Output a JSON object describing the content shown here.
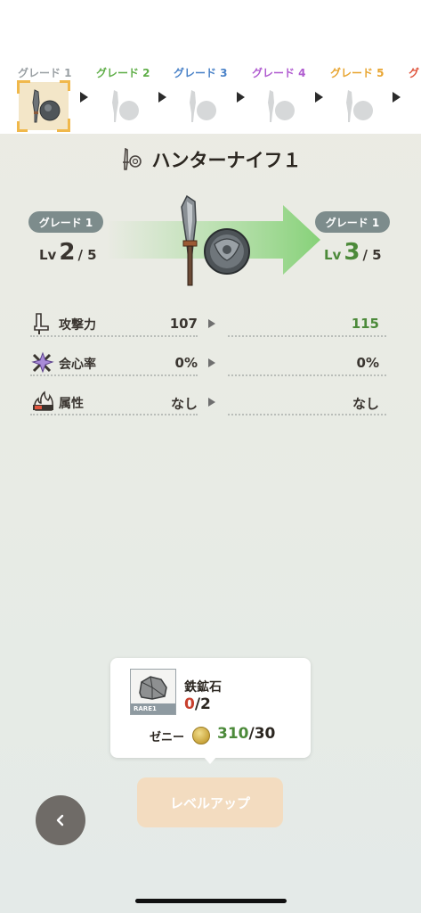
{
  "grades": [
    {
      "label": "グレード 1",
      "color": "#9aa0a4",
      "selected": true
    },
    {
      "label": "グレード 2",
      "color": "#5fae48",
      "selected": false
    },
    {
      "label": "グレード 3",
      "color": "#4a82c8",
      "selected": false
    },
    {
      "label": "グレード 4",
      "color": "#b05cd0",
      "selected": false
    },
    {
      "label": "グレード 5",
      "color": "#e8a531",
      "selected": false
    },
    {
      "label": "グ",
      "color": "#e0553e",
      "selected": false
    }
  ],
  "weapon": {
    "name": "ハンターナイフ１",
    "icon": "sword-shield-icon"
  },
  "upgrade": {
    "from": {
      "grade": "グレード 1",
      "lv_prefix": "Lv",
      "lv": "2",
      "max": "/ 5"
    },
    "to": {
      "grade": "グレード 1",
      "lv_prefix": "Lv",
      "lv": "3",
      "max": "/ 5"
    }
  },
  "stats": [
    {
      "icon": "attack-icon",
      "name": "攻撃力",
      "current": "107",
      "next": "115",
      "next_highlight": true
    },
    {
      "icon": "critical-icon",
      "name": "会心率",
      "current": "0%",
      "next": "0%",
      "next_highlight": false
    },
    {
      "icon": "element-icon",
      "name": "属性",
      "current": "なし",
      "next": "なし",
      "next_highlight": false
    }
  ],
  "material": {
    "name": "鉄鉱石",
    "rarity": "RARE1",
    "have": "0",
    "need": "/2",
    "zeny_label": "ゼニー",
    "zeny_have": "310",
    "zeny_need": "/30"
  },
  "buttons": {
    "level_up": "レベルアップ",
    "back_icon": "chevron-left-icon"
  },
  "colors": {
    "green": "#4c8a3a",
    "red": "#c8402e",
    "pill": "#7d8c8c",
    "level_up_disabled": "#f3dcc0"
  }
}
